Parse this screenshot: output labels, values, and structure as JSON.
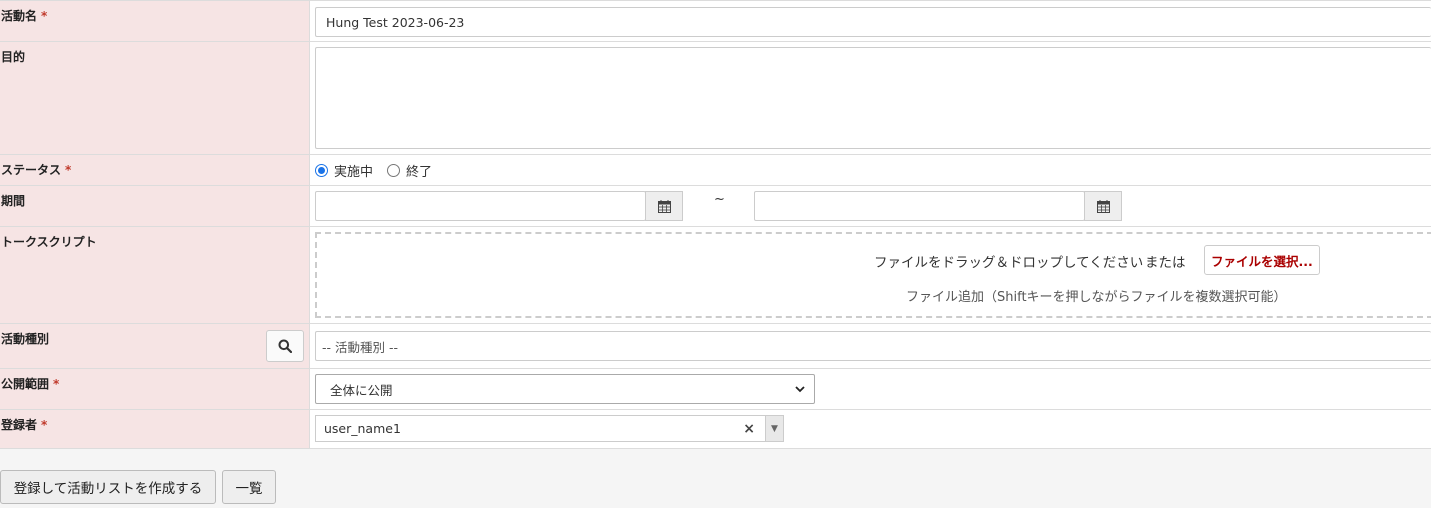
{
  "fields": {
    "activity_name": {
      "label": "活動名",
      "required_mark": "*",
      "value": "Hung Test 2023-06-23"
    },
    "purpose": {
      "label": "目的",
      "value": ""
    },
    "status": {
      "label": "ステータス",
      "required_mark": "*",
      "options": [
        "実施中",
        "終了"
      ],
      "selected": "実施中"
    },
    "period": {
      "label": "期間",
      "start": "",
      "end": "",
      "separator": "~"
    },
    "talk_script": {
      "label": "トークスクリプト",
      "drop_text": "ファイルをドラッグ＆ドロップしてください",
      "or_text": "または",
      "button_label": "ファイルを選択...",
      "hint": "ファイル追加（Shiftキーを押しながらファイルを複数選択可能）"
    },
    "activity_type": {
      "label": "活動種別",
      "placeholder": "-- 活動種別 --"
    },
    "visibility": {
      "label": "公開範囲",
      "required_mark": "*",
      "selected": "全体に公開"
    },
    "registrant": {
      "label": "登録者",
      "required_mark": "*",
      "value": "user_name1",
      "clear_glyph": "×",
      "arrow_glyph": "▼"
    }
  },
  "actions": {
    "submit_label": "登録して活動リストを作成する",
    "list_label": "一覧"
  },
  "colors": {
    "label_bg": "#f6e4e4",
    "required": "#c0392b",
    "file_button_text": "#aa0000",
    "radio_checked": "#1a73e8"
  }
}
